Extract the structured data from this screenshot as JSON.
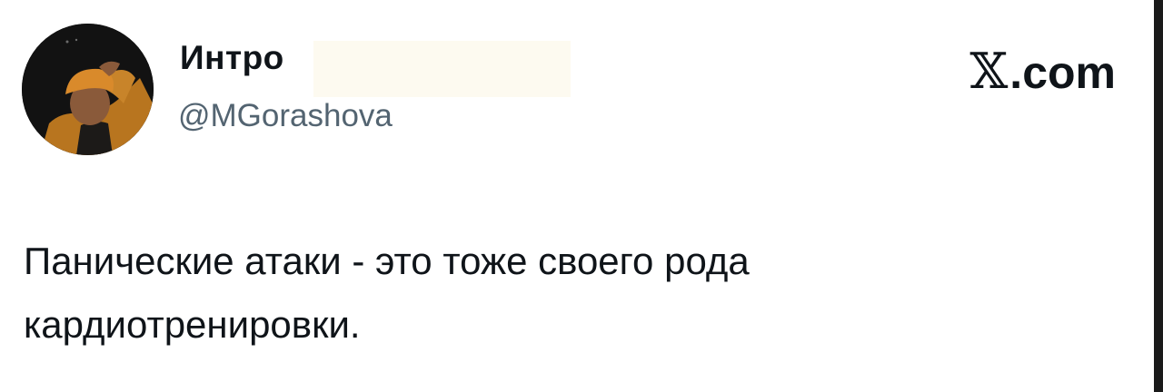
{
  "tweet": {
    "display_name": "Интро",
    "handle": "@MGorashova",
    "brand_mark": "𝕏",
    "brand_domain": ".com",
    "text": "Панические атаки - это тоже своего рода кардиотренировки."
  },
  "colors": {
    "text_primary": "#0f1419",
    "text_secondary": "#536471",
    "background": "#ffffff"
  }
}
